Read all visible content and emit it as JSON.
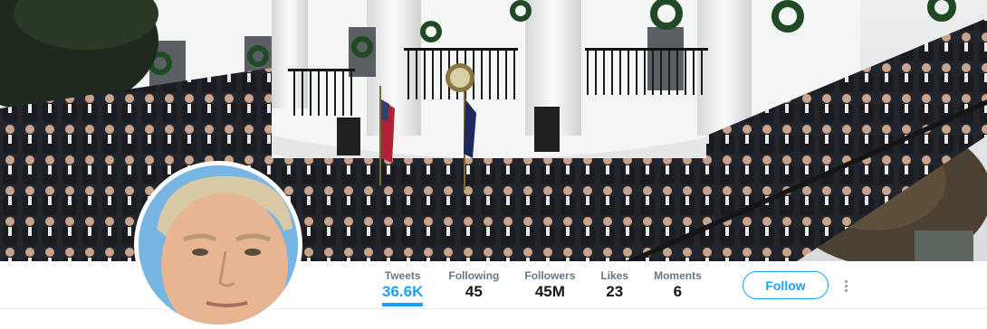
{
  "profile": {
    "header_image": "group-photo-header",
    "avatar_image": "profile-avatar"
  },
  "stats": [
    {
      "label": "Tweets",
      "value": "36.6K",
      "active": true
    },
    {
      "label": "Following",
      "value": "45",
      "active": false
    },
    {
      "label": "Followers",
      "value": "45M",
      "active": false
    },
    {
      "label": "Likes",
      "value": "23",
      "active": false
    },
    {
      "label": "Moments",
      "value": "6",
      "active": false
    }
  ],
  "actions": {
    "follow_label": "Follow",
    "more_icon": "more-vertical-icon"
  },
  "colors": {
    "accent": "#1da1f2",
    "label": "#657786",
    "value": "#14171a"
  }
}
